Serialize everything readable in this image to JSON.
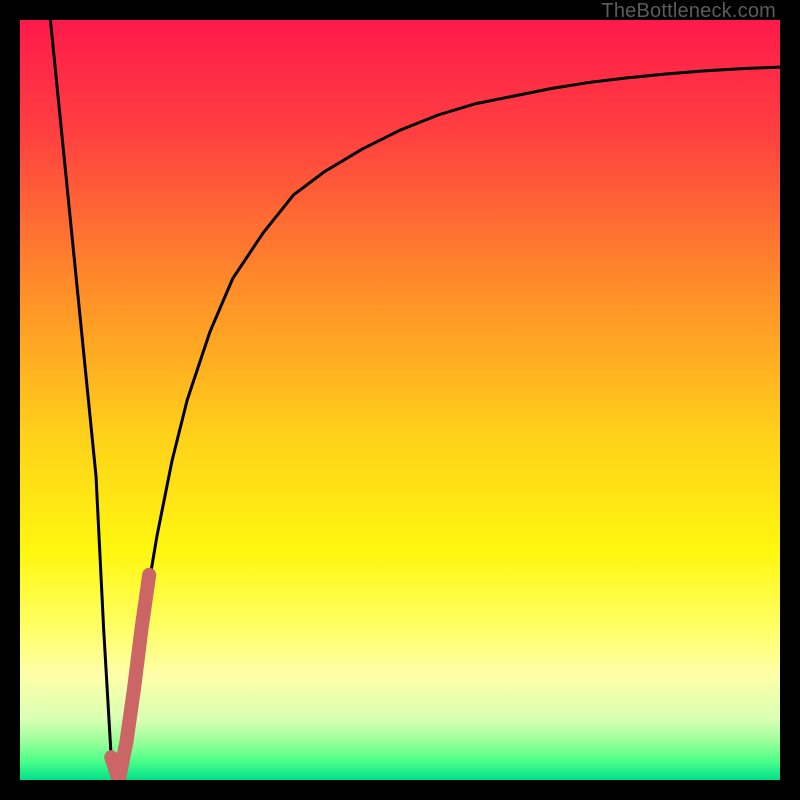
{
  "watermark": "TheBottleneck.com",
  "colors": {
    "background": "#000000",
    "watermark": "#5c5c5c",
    "curve": "#000000",
    "highlight": "#cc6666",
    "gradient_stops": [
      {
        "offset": 0.0,
        "color": "#ff1a4b"
      },
      {
        "offset": 0.15,
        "color": "#ff4040"
      },
      {
        "offset": 0.35,
        "color": "#ff8c29"
      },
      {
        "offset": 0.55,
        "color": "#ffd21a"
      },
      {
        "offset": 0.7,
        "color": "#fff70f"
      },
      {
        "offset": 0.8,
        "color": "#ffff66"
      },
      {
        "offset": 0.86,
        "color": "#ffffa8"
      },
      {
        "offset": 0.92,
        "color": "#d9ffb3"
      },
      {
        "offset": 0.95,
        "color": "#99ff99"
      },
      {
        "offset": 0.975,
        "color": "#4dff88"
      },
      {
        "offset": 1.0,
        "color": "#00e08a"
      }
    ]
  },
  "chart_data": {
    "type": "line",
    "title": "",
    "xlabel": "",
    "ylabel": "",
    "xlim": [
      0,
      100
    ],
    "ylim": [
      0,
      100
    ],
    "series": [
      {
        "name": "curve",
        "x": [
          4,
          6,
          8,
          10,
          11,
          12,
          13,
          14,
          15,
          16,
          18,
          20,
          22,
          25,
          28,
          32,
          36,
          40,
          45,
          50,
          55,
          60,
          65,
          70,
          75,
          80,
          85,
          90,
          95,
          100
        ],
        "y": [
          100,
          80,
          60,
          40,
          20,
          3,
          0,
          5,
          12,
          20,
          32,
          42,
          50,
          59,
          66,
          72,
          77,
          80,
          83,
          85.5,
          87.5,
          89,
          90,
          91,
          91.8,
          92.4,
          92.9,
          93.3,
          93.6,
          93.8
        ]
      },
      {
        "name": "highlight-band",
        "x": [
          12,
          13,
          14,
          15,
          16,
          17
        ],
        "y": [
          3,
          0,
          5,
          12,
          20,
          27
        ]
      }
    ]
  }
}
